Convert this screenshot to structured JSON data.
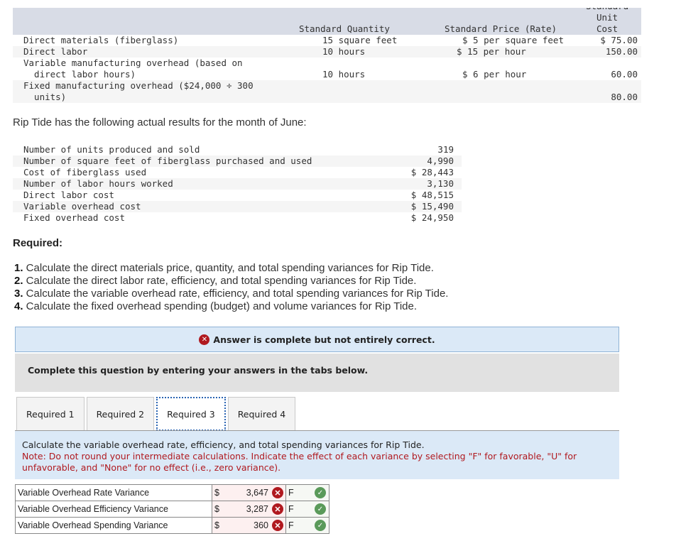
{
  "standards_table": {
    "headers": {
      "quantity": "Standard Quantity",
      "price": "Standard Price (Rate)",
      "unit_cost_top": "Standard",
      "unit_cost_mid": "Unit",
      "unit_cost_bottom": "Cost"
    },
    "rows": [
      {
        "label": "Direct materials (fiberglass)",
        "label2": "",
        "quantity": "15 square feet",
        "price": "$ 5 per square feet",
        "unit_cost": "$ 75.00"
      },
      {
        "label": "Direct labor",
        "label2": "",
        "quantity": "10 hours",
        "price": "$ 15 per hour",
        "unit_cost": "150.00"
      },
      {
        "label": "Variable manufacturing overhead (based on",
        "label2": "  direct labor hours)",
        "quantity": "10 hours",
        "price": "$ 6 per hour",
        "unit_cost": "60.00"
      },
      {
        "label": "Fixed manufacturing overhead ($24,000 ÷ 300",
        "label2": "  units)",
        "quantity": "",
        "price": "",
        "unit_cost": "80.00"
      }
    ]
  },
  "actual_intro": "Rip Tide has the following actual results for the month of June:",
  "actual_results": [
    {
      "label": "Number of units produced and sold",
      "value": "319"
    },
    {
      "label": "Number of square feet of fiberglass purchased and used",
      "value": "4,990"
    },
    {
      "label": "Cost of fiberglass used",
      "value": "$ 28,443"
    },
    {
      "label": "Number of labor hours worked",
      "value": "3,130"
    },
    {
      "label": "Direct labor cost",
      "value": "$ 48,515"
    },
    {
      "label": "Variable overhead cost",
      "value": "$ 15,490"
    },
    {
      "label": "Fixed overhead cost",
      "value": "$ 24,950"
    }
  ],
  "required": {
    "title": "Required:",
    "items": [
      {
        "num": "1.",
        "text": " Calculate the direct materials price, quantity, and total spending variances for Rip Tide."
      },
      {
        "num": "2.",
        "text": " Calculate the direct labor rate, efficiency, and total spending variances for Rip Tide."
      },
      {
        "num": "3.",
        "text": " Calculate the variable overhead rate, efficiency, and total spending variances for Rip Tide."
      },
      {
        "num": "4.",
        "text": " Calculate the fixed overhead spending (budget) and volume variances for Rip Tide."
      }
    ]
  },
  "banner": {
    "icon": "error-x-icon",
    "text": "Answer is complete but not entirely correct."
  },
  "instructions": "Complete this question by entering your answers in the tabs below.",
  "tabs": [
    {
      "label": "Required 1",
      "active": false
    },
    {
      "label": "Required 2",
      "active": false
    },
    {
      "label": "Required 3",
      "active": true
    },
    {
      "label": "Required 4",
      "active": false
    }
  ],
  "tab_panel": {
    "question": "Calculate the variable overhead rate, efficiency, and total spending variances for Rip Tide.",
    "note": "Note: Do not round your intermediate calculations. Indicate the effect of each variance by selecting \"F\" for favorable, \"U\" for unfavorable, and \"None\" for no effect (i.e., zero variance)."
  },
  "answers": [
    {
      "name": "Variable Overhead Rate Variance",
      "currency": "$",
      "amount": "3,647",
      "amount_status": "incorrect",
      "effect": "F",
      "effect_status": "correct"
    },
    {
      "name": "Variable Overhead Efficiency Variance",
      "currency": "$",
      "amount": "3,287",
      "amount_status": "incorrect",
      "effect": "F",
      "effect_status": "correct"
    },
    {
      "name": "Variable Overhead Spending Variance",
      "currency": "$",
      "amount": "360",
      "amount_status": "incorrect",
      "effect": "F",
      "effect_status": "correct"
    }
  ],
  "colors": {
    "error": "#b0191f",
    "success": "#5a9a5a",
    "panel_blue": "#dbe9f7",
    "header_gray": "#d8dce6"
  }
}
